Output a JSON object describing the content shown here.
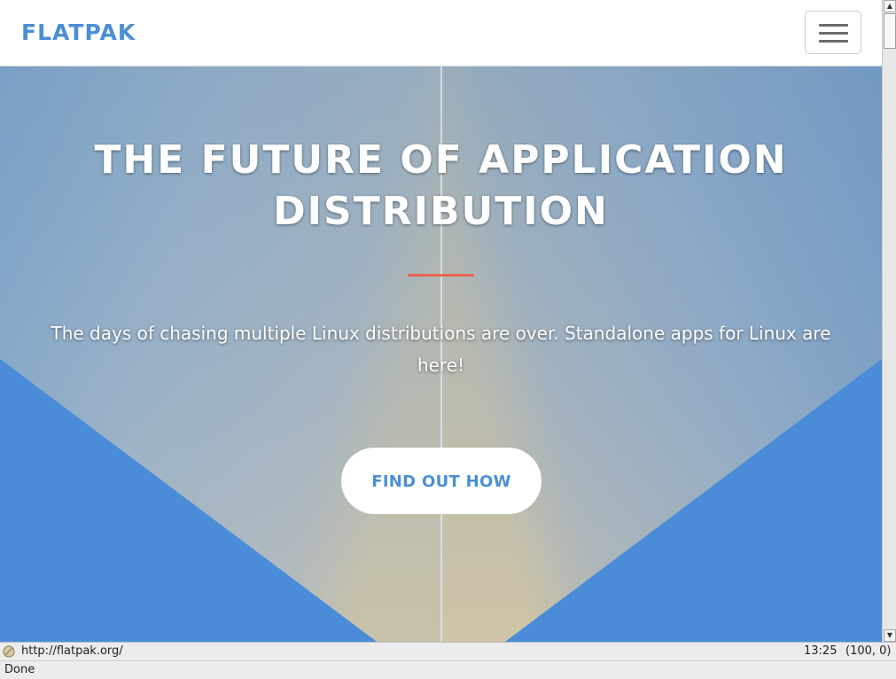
{
  "navbar": {
    "brand": "FLATPAK",
    "menu_icon": "hamburger-menu-icon"
  },
  "hero": {
    "title_line1": "THE FUTURE OF APPLICATION",
    "title_line2": "DISTRIBUTION",
    "subtitle_line1": "The days of chasing multiple Linux distributions are over. Standalone apps for Linux are",
    "subtitle_line2": "here!",
    "cta_label": "FIND OUT HOW"
  },
  "status": {
    "url": "http://flatpak.org/",
    "time": "13:25",
    "coords": "(100, 0)",
    "state": "Done"
  },
  "colors": {
    "brand": "#4a8fd4",
    "accent": "#e8644f",
    "hero_blue": "#4d8fd9"
  }
}
